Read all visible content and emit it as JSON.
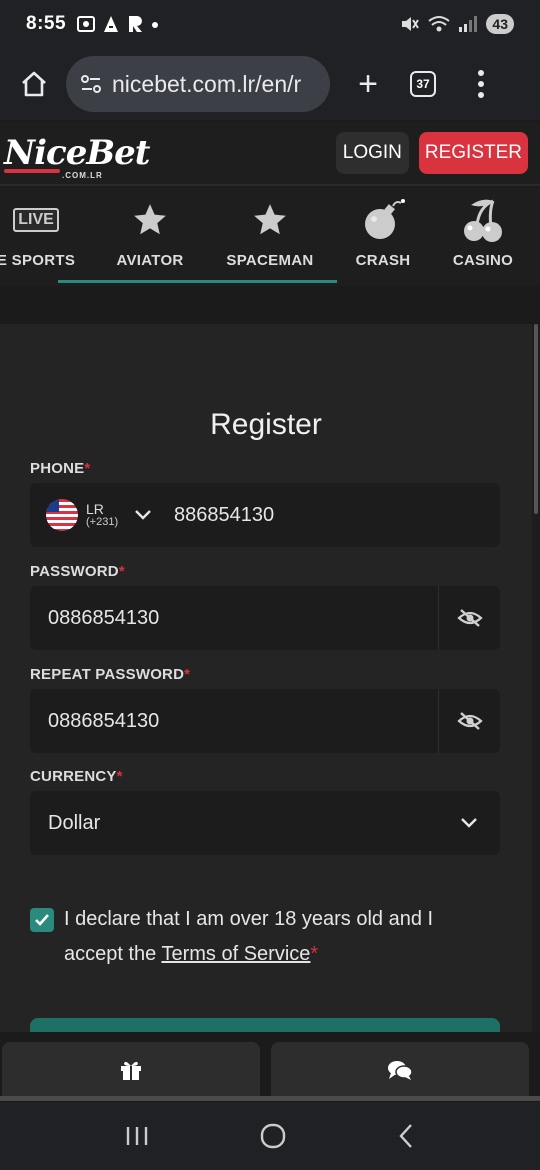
{
  "status_bar": {
    "time": "8:55",
    "left_icons": [
      "screenshot-icon",
      "a-icon",
      "r-icon",
      "dot-icon"
    ],
    "battery": "43"
  },
  "browser": {
    "url": "nicebet.com.lr/en/r",
    "tab_count": "37"
  },
  "header": {
    "logo_text": "NiceBet",
    "logo_sub": ".COM.LR",
    "login_label": "LOGIN",
    "register_label": "REGISTER"
  },
  "nav": {
    "items": [
      {
        "label": "E SPORTS",
        "icon": "live-badge",
        "badge": "LIVE"
      },
      {
        "label": "AVIATOR",
        "icon": "star-icon"
      },
      {
        "label": "SPACEMAN",
        "icon": "star-icon"
      },
      {
        "label": "CRASH",
        "icon": "bomb-icon"
      },
      {
        "label": "CASINO",
        "icon": "cherries-icon"
      }
    ]
  },
  "form": {
    "title": "Register",
    "phone_label": "PHONE",
    "country_code": "LR",
    "dial_code": "(+231)",
    "phone_value": "886854130",
    "password_label": "PASSWORD",
    "password_value": "0886854130",
    "repeat_password_label": "REPEAT PASSWORD",
    "repeat_password_value": "0886854130",
    "currency_label": "CURRENCY",
    "currency_value": "Dollar",
    "required_mark": "*",
    "declaration_text": "I declare that I am over 18 years old and I accept the ",
    "terms_link": "Terms of Service",
    "declaration_checked": true
  },
  "bottom_bar": {
    "left_icon": "gift-icon",
    "right_icon": "chat-icon"
  },
  "colors": {
    "accent": "#2b8a7e",
    "register_red": "#d8333f",
    "background": "#1b1b1b"
  }
}
